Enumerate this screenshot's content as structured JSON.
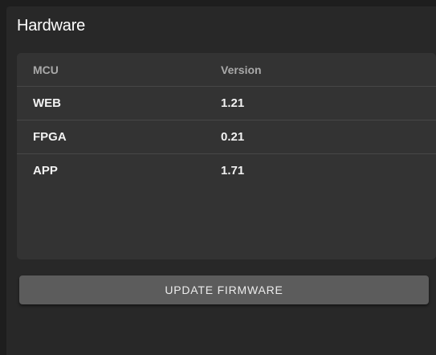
{
  "panel": {
    "title": "Hardware"
  },
  "table": {
    "headers": [
      "MCU",
      "Version"
    ],
    "rows": [
      [
        "WEB",
        "1.21"
      ],
      [
        "FPGA",
        "0.21"
      ],
      [
        "APP",
        "1.71"
      ]
    ]
  },
  "actions": {
    "update_label": "UPDATE FIRMWARE"
  }
}
